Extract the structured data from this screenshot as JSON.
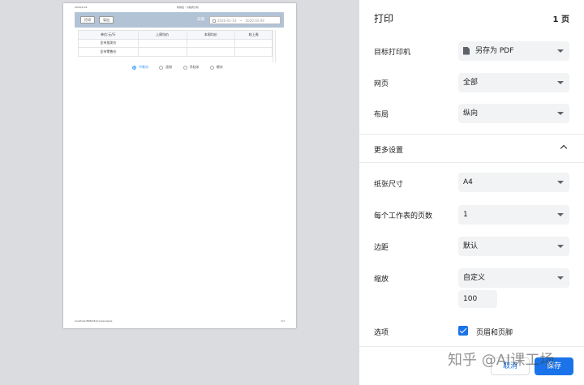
{
  "preview": {
    "header_left": "2020/1/16",
    "header_center": "新鲜店 · 价格周分析",
    "toolbar": {
      "print_label": "打印",
      "export_label": "导出",
      "date_label": "日期",
      "date_start": "2020-01-14",
      "date_separator": "~",
      "date_end": "2020-02-09"
    },
    "table": {
      "headers": [
        "单位:元/斤",
        "上周均价",
        "本周均价",
        "较上周"
      ],
      "rows": [
        [
          "全市批发价",
          "",
          "",
          ""
        ],
        [
          "全市零售价",
          "",
          "",
          ""
        ]
      ]
    },
    "radios": [
      {
        "label": "中晚米",
        "selected": true
      },
      {
        "label": "面粉",
        "selected": false
      },
      {
        "label": "早籼米",
        "selected": false
      },
      {
        "label": "粳米",
        "selected": false
      }
    ],
    "footer_left": "localhost:8080/#/priceAnalysis",
    "footer_right": "1/1"
  },
  "panel": {
    "title": "打印",
    "page_count": "1 页",
    "destination": {
      "label": "目标打印机",
      "value": "另存为 PDF",
      "icon": "file-icon"
    },
    "pages": {
      "label": "网页",
      "value": "全部"
    },
    "layout": {
      "label": "布局",
      "value": "纵向"
    },
    "more_settings": {
      "label": "更多设置",
      "icon": "chevron-up-icon"
    },
    "paper_size": {
      "label": "纸张尺寸",
      "value": "A4"
    },
    "pages_per_sheet": {
      "label": "每个工作表的页数",
      "value": "1"
    },
    "margins": {
      "label": "边距",
      "value": "默认"
    },
    "scale": {
      "label": "缩放",
      "value": "自定义",
      "custom_value": "100"
    },
    "options": {
      "label": "选项",
      "checkbox_label": "页眉和页脚",
      "checked": true
    },
    "cancel_label": "取消",
    "save_label": "保存",
    "accent_color": "#1a73e8"
  },
  "watermark": "知乎 @AI课工场"
}
